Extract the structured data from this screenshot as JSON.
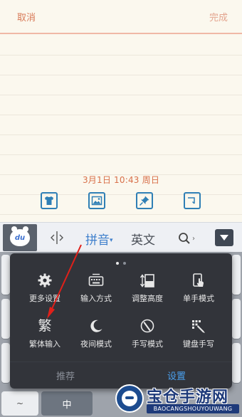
{
  "header": {
    "cancel_label": "取消",
    "done_label": "完成"
  },
  "note": {
    "datetime": "3月1日 10:43 周日",
    "tools": [
      "shirt-icon",
      "image-icon",
      "pin-icon",
      "clock-icon"
    ]
  },
  "ime_bar": {
    "logo_text": "du",
    "pinyin_label": "拼音",
    "pinyin_caret": "▾",
    "english_label": "英文",
    "search_chevron": "›",
    "colors": {
      "accent": "#3e7fcc",
      "logo_bg": "#5a616c"
    }
  },
  "popup": {
    "items": [
      {
        "label": "更多设置",
        "icon": "gear-icon"
      },
      {
        "label": "输入方式",
        "icon": "keyboard-icon"
      },
      {
        "label": "调整高度",
        "icon": "height-adjust-icon"
      },
      {
        "label": "单手模式",
        "icon": "one-hand-icon"
      },
      {
        "label": "繁体输入",
        "icon": "traditional-char-icon",
        "glyph": "繁"
      },
      {
        "label": "夜间模式",
        "icon": "moon-icon"
      },
      {
        "label": "手写模式",
        "icon": "handwriting-icon"
      },
      {
        "label": "键盘手写",
        "icon": "keyboard-handwriting-icon"
      }
    ],
    "tabs": [
      {
        "label": "推荐",
        "active": false
      },
      {
        "label": "设置",
        "active": true
      }
    ],
    "page_indicator": {
      "count": 2,
      "active_index": 0
    }
  },
  "keyboard": {
    "zh_key": "中",
    "tilde_key": "~"
  },
  "watermark": {
    "title": "宝仓手游网",
    "subtitle": "BAOCANGSHOUYOUWANG"
  }
}
